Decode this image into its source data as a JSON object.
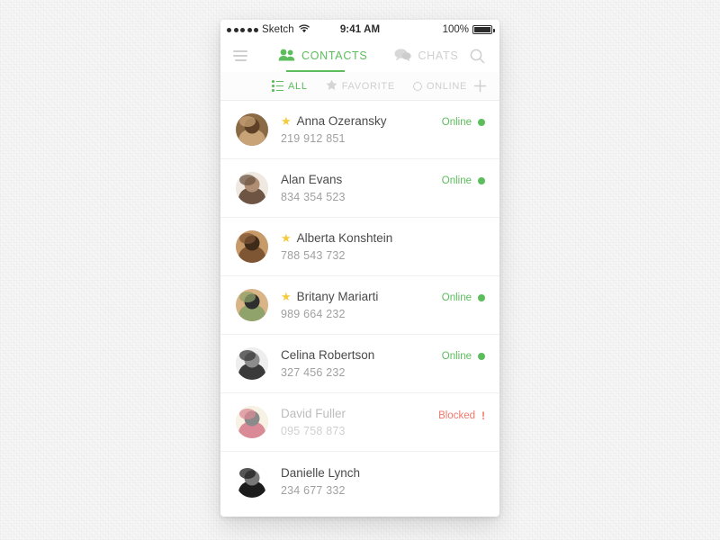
{
  "status_bar": {
    "signal_dots": 5,
    "carrier": "Sketch",
    "wifi_icon": "wifi-icon",
    "time": "9:41 AM",
    "battery_percent": "100%",
    "battery_icon": "battery-full-icon"
  },
  "nav": {
    "menu_icon": "hamburger-menu-icon",
    "tabs": [
      {
        "label": "CONTACTS",
        "icon": "contacts-people-icon",
        "active": true
      },
      {
        "label": "CHATS",
        "icon": "chats-bubbles-icon",
        "active": false
      }
    ],
    "search_icon": "search-icon",
    "active_color": "#5cbd5c",
    "inactive_color": "#cfcfcf"
  },
  "filters": {
    "items": [
      {
        "label": "ALL",
        "icon": "list-icon",
        "active": true
      },
      {
        "label": "FAVORITE",
        "icon": "star-icon",
        "active": false
      },
      {
        "label": "ONLINE",
        "icon": "circle-outline-icon",
        "active": false
      }
    ],
    "add_label": "+",
    "add_icon": "plus-icon"
  },
  "contacts": [
    {
      "name": "Anna Ozeransky",
      "phone": "219 912 851",
      "favorite": true,
      "status": "Online",
      "status_type": "online",
      "avatar": "photo-woman-brown-hair",
      "avatar_colors": [
        "#8a6a45",
        "#c9a378",
        "#5e4027"
      ]
    },
    {
      "name": "Alan Evans",
      "phone": "834 354 523",
      "favorite": false,
      "status": "Online",
      "status_type": "online",
      "avatar": "photo-man-beard",
      "avatar_colors": [
        "#efe9e2",
        "#6e5443",
        "#b08e74"
      ]
    },
    {
      "name": "Alberta Konshtein",
      "phone": "788 543 732",
      "favorite": true,
      "status": "",
      "status_type": "none",
      "avatar": "photo-woman-dark-hair",
      "avatar_colors": [
        "#c79a6a",
        "#7e5634",
        "#3e2a19"
      ]
    },
    {
      "name": "Britany Mariarti",
      "phone": "989 664 232",
      "favorite": true,
      "status": "Online",
      "status_type": "online",
      "avatar": "photo-woman-sunglasses",
      "avatar_colors": [
        "#d9b486",
        "#8fa36a",
        "#2e2e2e"
      ]
    },
    {
      "name": "Celina Robertson",
      "phone": "327 456 232",
      "favorite": false,
      "status": "Online",
      "status_type": "online",
      "avatar": "photo-woman-bw",
      "avatar_colors": [
        "#eeeeee",
        "#3a3a3a",
        "#8c8c8c"
      ]
    },
    {
      "name": "David Fuller",
      "phone": "095 758 873",
      "favorite": false,
      "status": "Blocked",
      "status_type": "blocked",
      "avatar": "photo-lipstick",
      "avatar_colors": [
        "#f7f2e4",
        "#d98a96",
        "#8a8a8a"
      ]
    },
    {
      "name": "Danielle Lynch",
      "phone": "234 677 332",
      "favorite": false,
      "status": "",
      "status_type": "none",
      "avatar": "illustration-face-glasses",
      "avatar_colors": [
        "#ffffff",
        "#1c1c1c",
        "#777777"
      ]
    }
  ],
  "overlay": {
    "touch_indicator": "touch-point-circle"
  },
  "colors": {
    "accent_green": "#5cbd5c",
    "blocked_red": "#f2786b",
    "star_yellow": "#f5ca3c",
    "name_gray": "#4a4a4a",
    "phone_gray": "#a0a0a0",
    "muted_gray": "#cfcfcf"
  }
}
